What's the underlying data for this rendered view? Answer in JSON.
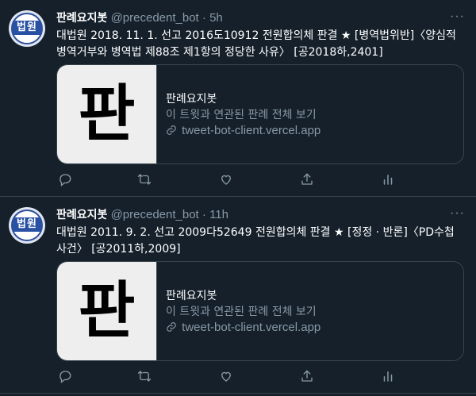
{
  "tweets": [
    {
      "avatar_text": "법원",
      "display_name": "판례요지봇",
      "handle": "@precedent_bot",
      "separator": "·",
      "time": "5h",
      "more_label": "···",
      "text": "대법원 2018. 11. 1. 선고 2016도10912 전원합의체 판결 ★ [병역법위반]〈양심적 병역거부와 병역법 제88조 제1항의 정당한 사유〉 [공2018하,2401]",
      "card": {
        "thumb_glyph": "판",
        "title": "판례요지봇",
        "description": "이 트윗과 연관된 판례 전체 보기",
        "link": "tweet-bot-client.vercel.app"
      },
      "actions": [
        "reply-icon",
        "retweet-icon",
        "like-icon",
        "share-icon",
        "analytics-icon"
      ]
    },
    {
      "avatar_text": "법원",
      "display_name": "판례요지봇",
      "handle": "@precedent_bot",
      "separator": "·",
      "time": "11h",
      "more_label": "···",
      "text": "대법원 2011. 9. 2. 선고 2009다52649 전원합의체 판결 ★ [정정 · 반론]〈PD수첩 사건〉 [공2011하,2009]",
      "card": {
        "thumb_glyph": "판",
        "title": "판례요지봇",
        "description": "이 트윗과 연관된 판례 전체 보기",
        "link": "tweet-bot-client.vercel.app"
      },
      "actions": [
        "reply-icon",
        "retweet-icon",
        "like-icon",
        "share-icon",
        "analytics-icon"
      ]
    }
  ],
  "colors": {
    "background": "#15202b",
    "border": "#38444d",
    "muted": "#8899a6",
    "text": "#ffffff"
  }
}
